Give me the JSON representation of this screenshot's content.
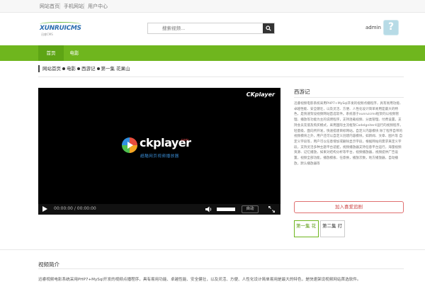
{
  "topbar": {
    "links": [
      "网站首页",
      "手机网站",
      "用户中心"
    ]
  },
  "header": {
    "logo_text": "XUNRUICMS",
    "logo_sub": "迅睿CMS",
    "search_placeholder": "搜索视频...",
    "user_name": "admin",
    "avatar_glyph": "?"
  },
  "nav": {
    "items": [
      "首页",
      "电影"
    ]
  },
  "breadcrumb": {
    "items": [
      "网站首页",
      "电影",
      "西游记",
      "第一集 花果山"
    ]
  },
  "player": {
    "brand": "CKplayer",
    "logo_main": "ckplayer",
    "logo_com": ".com",
    "logo_slogan": "超酷网页视频播放器",
    "time": "00:00:00 / 00:00:00",
    "auto_label": "自动",
    "progress": 0,
    "volume": 1.0
  },
  "side": {
    "title": "西游记",
    "description": "迅睿视频电影系统采用PHP7+MySql开发的视频点播程序，具有易用功能、卓越性能、安全健壮，以及灵活、方便、人性化设计简单易用是最大的特色，是快速架设视频网站首选软件。系统基于xunruicms框架的以视频管理、播放等功能为主的说明程序，支持连载视频、分类管理、付费设置，支持会员充值及购买模式，采用国际主流框架CodeIgniter4运行的视频程序，轻量级，面向所开发，快速搭建目标网站。自定义内容模块 除了程序自带的视频模块之外，用户还可以自定义创建内容模块，如新闻、文章、图片等 自定义字段等，用户可以任意增加或删除显示字段，根据网站的需求来定义字段，支持灵活多种主题平台适配，视频播放器支持任意平台运行，海量视频资源、记忆播放，如果对结构分析等平台，视频播放器，视频提供广告设置，视频全部功能，播放模板、任意换，播放次数，地方播放器，自动播放，默认播放器等",
    "like_label": "加入喜爱追剧",
    "episodes": [
      {
        "label": "第一集 花",
        "active": true
      },
      {
        "label": "第二集 打",
        "active": false
      }
    ]
  },
  "intro": {
    "title": "视频简介",
    "text": "迅睿视频电影系统采用PHP7+MySql开发的视频点播程序，具有易用功能、卓越性能、安全健壮，以及灵活、方便、人性化设计简单易用是最大的特色，是快速架设视频网站首选软件。"
  },
  "colors": {
    "nav_green": "#6fb61e",
    "like_red": "#cc4444",
    "player_bg": "#000000"
  }
}
